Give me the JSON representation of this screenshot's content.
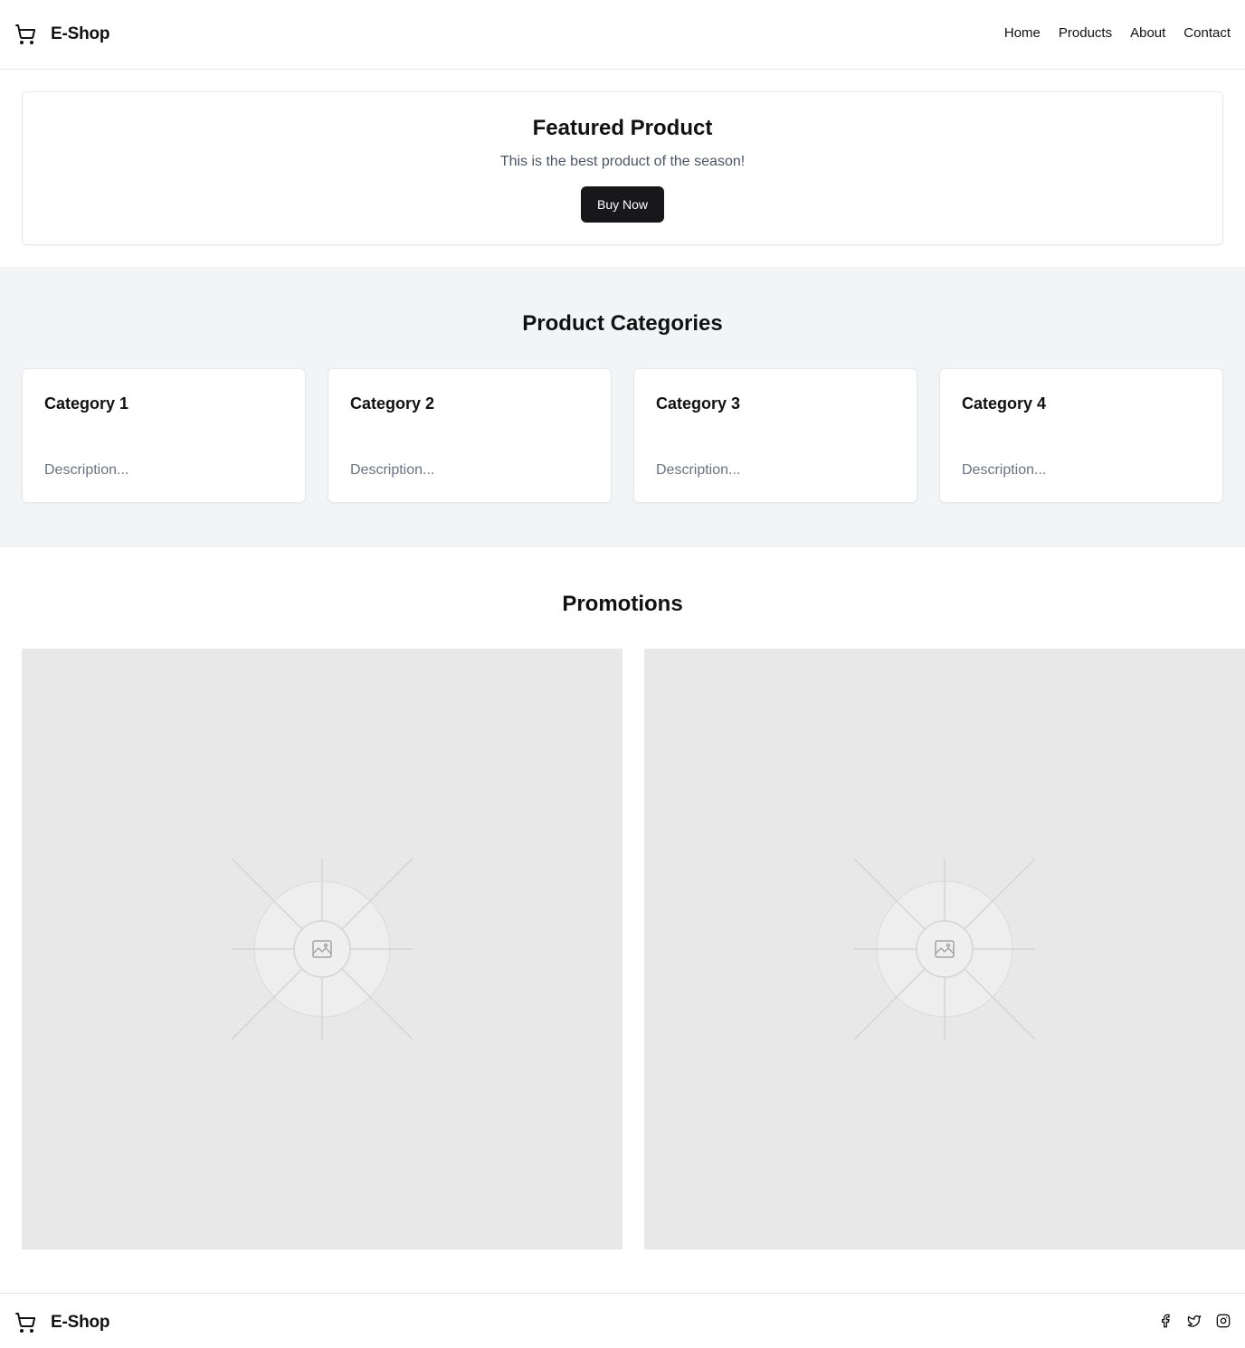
{
  "header": {
    "brand": "E-Shop",
    "brand_icon": "shopping-cart-icon",
    "nav": [
      "Home",
      "Products",
      "About",
      "Contact"
    ]
  },
  "featured": {
    "title": "Featured Product",
    "subtitle": "This is the best product of the season!",
    "button": "Buy Now"
  },
  "categories": {
    "title": "Product Categories",
    "items": [
      {
        "name": "Category 1",
        "description": "Description..."
      },
      {
        "name": "Category 2",
        "description": "Description..."
      },
      {
        "name": "Category 3",
        "description": "Description..."
      },
      {
        "name": "Category 4",
        "description": "Description..."
      }
    ]
  },
  "promotions": {
    "title": "Promotions",
    "images": [
      "image-placeholder-icon",
      "image-placeholder-icon"
    ]
  },
  "footer": {
    "brand": "E-Shop",
    "social": [
      "facebook-icon",
      "twitter-icon",
      "instagram-icon"
    ]
  },
  "colors": {
    "button_bg": "#18181b",
    "section_bg": "#f2f4f6",
    "placeholder_bg": "#e8e8e8",
    "muted_text": "#6b7280"
  }
}
